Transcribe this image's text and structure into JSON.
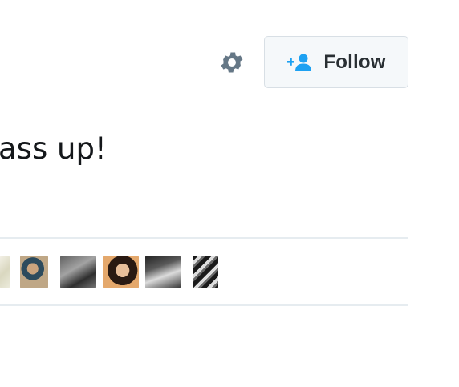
{
  "header": {
    "settings_icon": "gear-icon",
    "follow_button": {
      "label": "Follow",
      "icon": "add-user-icon",
      "icon_color": "#1da1f2"
    }
  },
  "tweet": {
    "text": "ass up!"
  },
  "likes": {
    "avatars": [
      {
        "name": "avatar-1"
      },
      {
        "name": "avatar-2"
      },
      {
        "name": "avatar-3"
      },
      {
        "name": "avatar-4"
      },
      {
        "name": "avatar-5"
      },
      {
        "name": "avatar-6"
      }
    ]
  },
  "colors": {
    "accent": "#1da1f2",
    "button_bg": "#f5f8fa",
    "button_border": "#d8dfe5",
    "divider": "#e6ecf0",
    "icon_gray": "#657786"
  }
}
